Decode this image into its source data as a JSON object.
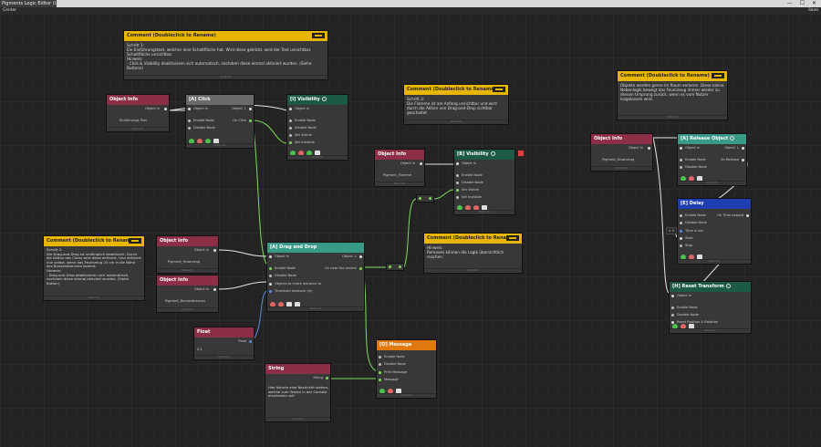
{
  "window": {
    "tab_title": "Pigments Logic Editor (Un...",
    "controls": "— ☐ ✕"
  },
  "toolbar": {
    "left": "Center",
    "right": "Save"
  },
  "colors": {
    "object_info": "#8c2f46",
    "action_grey": "#6a6a6a",
    "event_teal": "#3a9a88",
    "delay_blue": "#1f3fb0",
    "message_orange": "#e07a10",
    "comment_yellow": "#e8b500",
    "visibility_green": "#1c5a46",
    "wire_green": "#7fdc5c",
    "wire_white": "#e6e6e6",
    "wire_blue": "#5a8ee0"
  },
  "common": {
    "object_in": "Object In",
    "object_out": "Object ↓",
    "enable": "Enable Node",
    "disable": "Disable Node",
    "footer": "Node info"
  },
  "comments": [
    {
      "title": "Comment (Doubleclick to Rename)",
      "text": "Schritt 1:\nEin Einführungstext, welcher eine Schaltfläche hat. Wird diese geklickt, wird der Text unsichtbar. Schaltfläche unsichtbar.\nHinweis:\n- Click & Visibility deaktivieren sich automatisch, nachdem diese einmal aktiviert wurden. (Siehe Buttons)"
    },
    {
      "title": "Comment (Doubleclick to Rename)",
      "text": "Schritt 3:\nDie Flamme ist am Anfang unsichtbar und wird durch die Aktion von Drag-and-Drop sichtbar geschaltet"
    },
    {
      "title": "Comment (Doubleclick to Rename)",
      "text": "Objekte werden gerne im Raum verloren. Diese kleine Nebenlogik bewegt das Feuerzeug immer wieder zu dessen Ursprung zurück, wenn es vom Nutzer losgelassen wird."
    },
    {
      "title": "Comment (Doubleclick to Rename)",
      "text": "Schritt 2:\nDie Drag-and-Drop ist umfänglich deaktiviert. Durch die Aktion des Clicks wird diese aktiviert. Und aktiviert nun selbst, wenn das Feuerzeug 20 cm in die Nähe des Bunsenbrenners kommt.\nHinweis:\n- Drag-and-Drop deaktivieren sich automatisch, nachdem diese einmal aktiviert wurden. (Siehe Button)"
    },
    {
      "title": "Comment (Doubleclick to Rename)",
      "text": "Hinweis:\nRemoves können die Logik übersichtlich machen."
    }
  ],
  "objinfo": [
    {
      "title": "Object Info",
      "value": "Einführungs Text"
    },
    {
      "title": "Object Info",
      "value": "Pigment_Flamme"
    },
    {
      "title": "Object Info",
      "value": "Pigment_Feuerzeug"
    },
    {
      "title": "Object Info",
      "value": "Pigment_Feuerzeug"
    },
    {
      "title": "Object Info",
      "value": "Pigment_Bunsenbrenner"
    }
  ],
  "click": {
    "title": "[A] Click",
    "object_in": "Object In",
    "object_out": "Object ↓",
    "on_click": "On Click"
  },
  "vis1": {
    "title": "[I] Visibility",
    "set_visible": "Set Visible",
    "set_invisible": "Set Invisible"
  },
  "vis2": {
    "title": "[B] Visibility",
    "set_visible": "Set Visible",
    "set_invisible": "Set Invisible"
  },
  "drag": {
    "title": "[A] Drag and Drop",
    "on_near": "On near the anchor",
    "objects": "Objects to check distance to",
    "threshold": "Threshold distance (m)"
  },
  "release": {
    "title": "[A] Release Object",
    "on_release": "On Release"
  },
  "delay": {
    "title": "[E] Delay",
    "on_time": "On Time passed",
    "time": "Time in sec",
    "start": "Start",
    "stop": "Stop",
    "value": "0.5"
  },
  "reset": {
    "title": "[H] Reset Transform",
    "reset_pos": "Reset Position & Rotation"
  },
  "float": {
    "title": "Float",
    "label": "Float",
    "value": "0.2"
  },
  "string": {
    "title": "String",
    "label": "String",
    "value": "Hier könnte eine Nachricht stehen, welche zum Testen in der Console erscheinen soll"
  },
  "message": {
    "title": "[O] Message",
    "print": "Print Message",
    "message": "Message"
  }
}
